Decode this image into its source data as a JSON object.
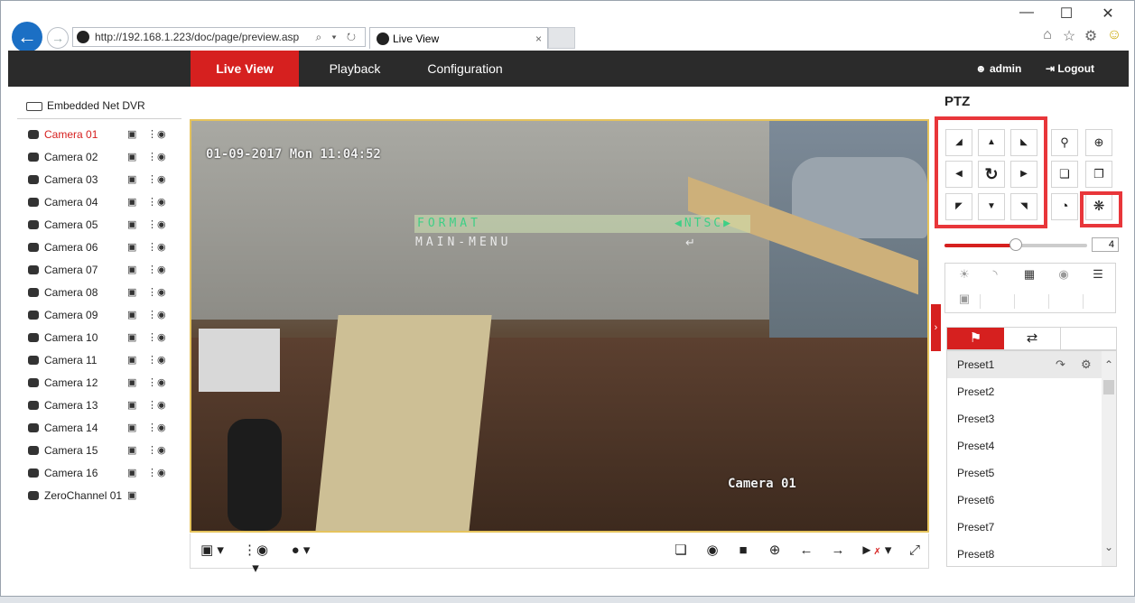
{
  "browser": {
    "url": "http://192.168.1.223/doc/page/preview.asp",
    "tab_title": "Live View",
    "tab_close": "×",
    "address_tools": "⌕ ▾ ↻",
    "window_controls": {
      "minimize": "—",
      "maximize": "☐",
      "close": "✕"
    },
    "toolbar_icons": {
      "home": "⌂",
      "favorites": "☆",
      "settings": "⚙",
      "smiley": "☺"
    }
  },
  "nav": {
    "items": [
      "Live View",
      "Playback",
      "Configuration"
    ],
    "active": "Live View",
    "user": "admin",
    "logout": "Logout"
  },
  "sidebar": {
    "device": "Embedded Net DVR",
    "selected": "Camera 01",
    "cameras": [
      "Camera 01",
      "Camera 02",
      "Camera 03",
      "Camera 04",
      "Camera 05",
      "Camera 06",
      "Camera 07",
      "Camera 08",
      "Camera 09",
      "Camera 10",
      "Camera 11",
      "Camera 12",
      "Camera 13",
      "Camera 14",
      "Camera 15",
      "Camera 16",
      "ZeroChannel 01"
    ]
  },
  "video": {
    "timestamp": "01-09-2017 Mon 11:04:52",
    "camera_label": "Camera 01",
    "osd_menu": {
      "format_label": "FORMAT",
      "format_value": "NTSC",
      "main_menu": "MAIN-MENU",
      "return_symbol": "↵"
    }
  },
  "video_toolbar": {
    "left": [
      "window-layout",
      "stream",
      "microphone"
    ],
    "right": [
      "stop-all",
      "capture",
      "record",
      "digital-zoom",
      "prev",
      "next",
      "volume",
      "fullscreen"
    ]
  },
  "ptz": {
    "title": "PTZ",
    "speed": "4",
    "speed_fraction": 0.5,
    "highlight_color": "#e8363a",
    "accent_color": "#d6201f",
    "presets": [
      "Preset1",
      "Preset2",
      "Preset3",
      "Preset4",
      "Preset5",
      "Preset6",
      "Preset7",
      "Preset8"
    ],
    "selected_preset": "Preset1"
  }
}
